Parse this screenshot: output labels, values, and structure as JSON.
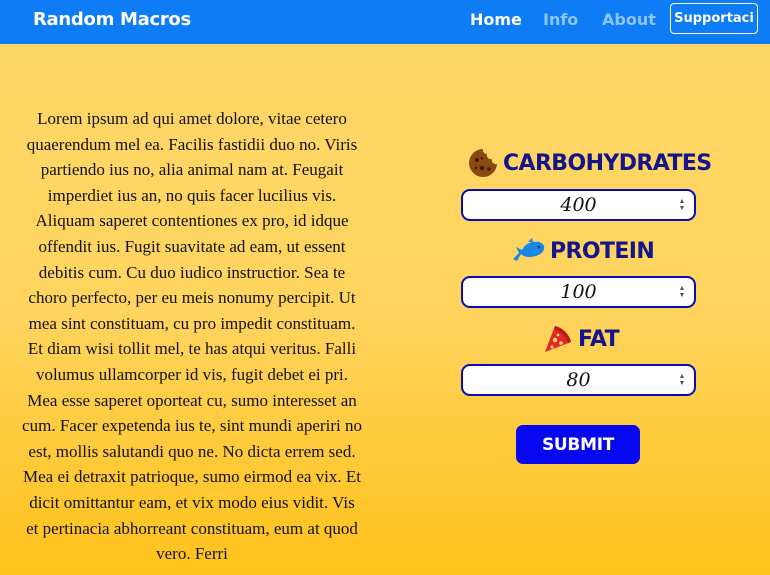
{
  "navbar": {
    "brand": "Random Macros",
    "links": [
      {
        "label": "Home",
        "active": true
      },
      {
        "label": "Info",
        "active": false
      },
      {
        "label": "About",
        "active": false
      }
    ],
    "support_label": "Supportaci",
    "background": "#0d7cf5"
  },
  "content": {
    "lorem": "Lorem ipsum ad qui amet dolore, vitae cetero quaerendum mel ea. Facilis fastidii duo no. Viris partiendo ius no, alia animal nam at. Feugait imperdiet ius an, no quis facer lucilius vis. Aliquam saperet contentiones ex pro, id idque offendit ius. Fugit suavitate ad eam, ut essent debitis cum. Cu duo iudico instructior. Sea te choro perfecto, per eu meis nonumy percipit. Ut mea sint constituam, cu pro impedit constituam. Et diam wisi tollit mel, te has atqui veritus. Falli volumus ullamcorper id vis, fugit debet ei pri. Mea esse saperet oporteat cu, sumo interesset an cum. Facer expetenda ius te, sint mundi aperiri no est, mollis salutandi quo ne. No dicta errem sed. Mea ei detraxit patrioque, sumo eirmod ea vix. Et dicit omittantur eam, et vix modo eius vidit. Vis et pertinacia abhorreant constituam, eum at quod vero. Ferri"
  },
  "form": {
    "carbohydrates": {
      "label": "CARBOHYDRATES",
      "value": "400",
      "icon": "cookie-icon"
    },
    "protein": {
      "label": "PROTEIN",
      "value": "100",
      "icon": "fish-icon"
    },
    "fat": {
      "label": "FAT",
      "value": "80",
      "icon": "pizza-icon"
    },
    "submit_label": "SUBMIT",
    "title_color": "#14148c",
    "border_color": "#0a0ab8",
    "submit_color": "#0808f0"
  }
}
